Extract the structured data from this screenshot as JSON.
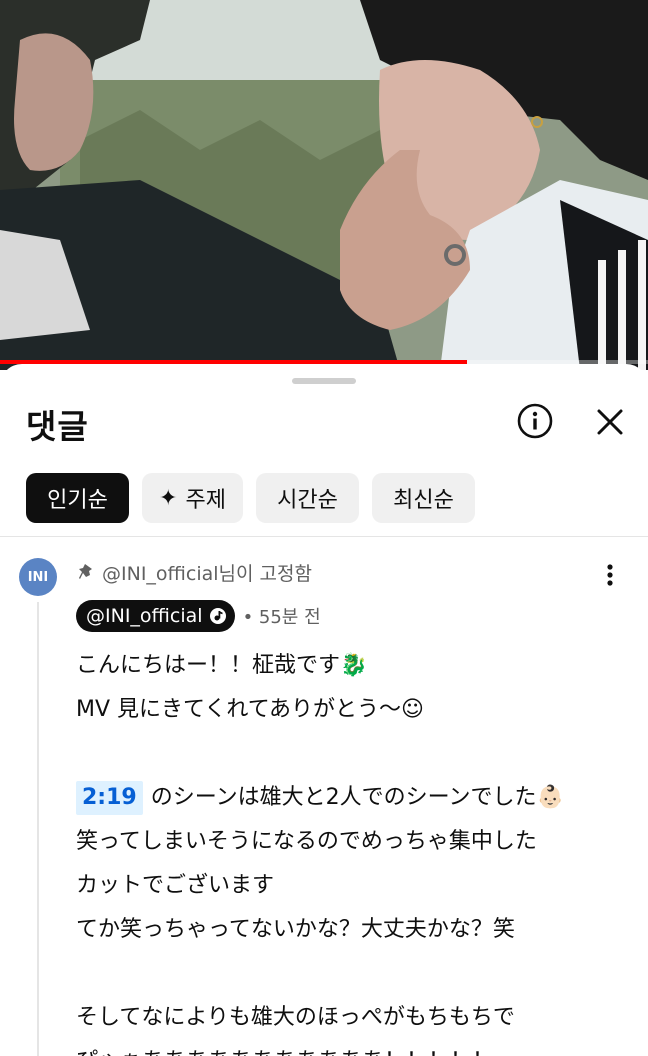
{
  "video": {
    "progress_fraction": 0.72
  },
  "sheet": {
    "title": "댓글",
    "info_icon": "info-icon",
    "close_icon": "close-icon"
  },
  "chips": [
    {
      "label": "인기순",
      "active": true
    },
    {
      "label": "주제",
      "icon": "sparkle-icon",
      "active": false
    },
    {
      "label": "시간순",
      "active": false
    },
    {
      "label": "최신순",
      "active": false
    }
  ],
  "comment": {
    "avatar_text": "INI",
    "avatar_color": "#5a84c4",
    "pinned_text": "@INI_official님이 고정함",
    "author": "@INI_official",
    "time": "• 55분 전",
    "lines": [
      "こんにちはー！！柾哉です🐉",
      "MV 見にきてくれてありがとう〜☺",
      "",
      {
        "timestamp": "2:19",
        "text": "のシーンは雄大と2人でのシーンでした👶🏻"
      },
      "笑ってしまいそうになるのでめっちゃ集中した",
      "カットでございます",
      "てか笑っちゃってないかな？大丈夫かな？笑",
      "",
      "そしてなによりも雄大のほっぺがもちもちで",
      "ぴゃぁあああああああああああ！！！！！"
    ]
  },
  "colors": {
    "progress": "#ff0000",
    "timestamp_link": "#065fd4",
    "timestamp_bg": "#def1ff"
  }
}
